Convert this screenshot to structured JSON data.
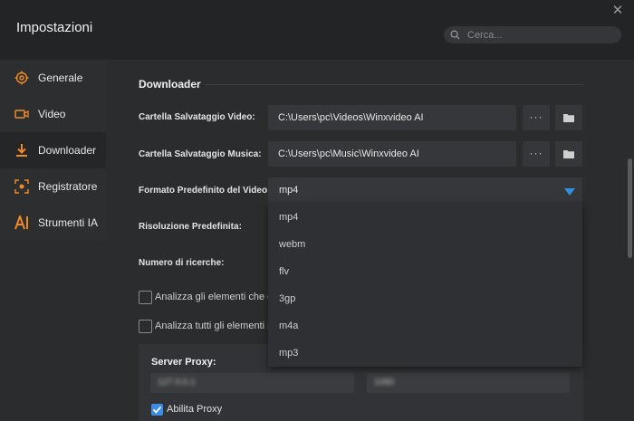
{
  "window": {
    "title": "Impostazioni"
  },
  "search": {
    "placeholder": "Cerca..."
  },
  "sidebar": {
    "items": [
      {
        "label": "Generale",
        "icon": "gear-icon"
      },
      {
        "label": "Video",
        "icon": "video-camera-icon"
      },
      {
        "label": "Downloader",
        "icon": "download-icon"
      },
      {
        "label": "Registratore",
        "icon": "screen-record-icon"
      },
      {
        "label": "Strumenti IA",
        "icon": "ai-icon"
      }
    ],
    "active_index": 2
  },
  "downloader": {
    "section_title": "Downloader",
    "video_folder_label": "Cartella Salvataggio Video:",
    "video_folder_value": "C:\\Users\\pc\\Videos\\Winxvideo AI",
    "music_folder_label": "Cartella Salvataggio Musica:",
    "music_folder_value": "C:\\Users\\pc\\Music\\Winxvideo AI",
    "browse_label": "···",
    "format_label": "Formato Predefinito del Video:",
    "format_value": "mp4",
    "format_options": [
      "mp4",
      "webm",
      "flv",
      "3gp",
      "m4a",
      "mp3"
    ],
    "resolution_label": "Risoluzione Predefinita:",
    "search_count_label": "Numero di ricerche:",
    "analyze_option_1": "Analizza gli elementi che er",
    "analyze_option_2": "Analizza tutti gli elementi ne",
    "proxy_title": "Server Proxy:",
    "proxy_host": "127.0.0.1",
    "proxy_port": "1080",
    "enable_proxy_label": "Abilita Proxy",
    "enable_proxy_checked": true
  },
  "colors": {
    "accent": "#3d8de6",
    "caret": "#2f8fe0",
    "download_icon": "#f08a24"
  }
}
